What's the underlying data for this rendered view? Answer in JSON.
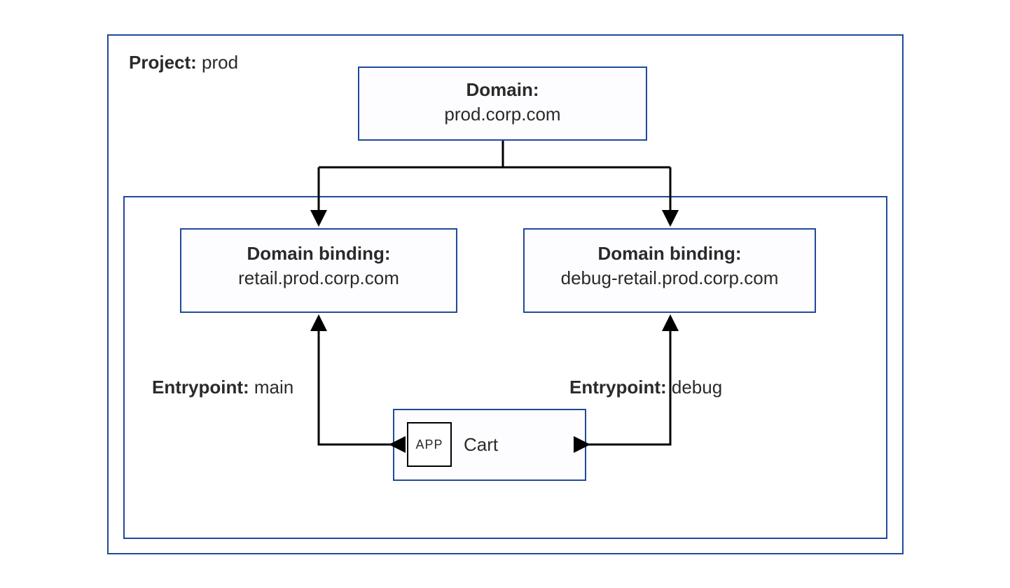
{
  "project": {
    "label_key": "Project:",
    "label_value": "prod"
  },
  "domain": {
    "title": "Domain:",
    "value": "prod.corp.com"
  },
  "bindings": {
    "left": {
      "title": "Domain binding:",
      "value": "retail.prod.corp.com"
    },
    "right": {
      "title": "Domain binding:",
      "value": "debug-retail.prod.corp.com"
    }
  },
  "entrypoints": {
    "left": {
      "label_key": "Entrypoint:",
      "label_value": "main"
    },
    "right": {
      "label_key": "Entrypoint:",
      "label_value": "debug"
    }
  },
  "app": {
    "badge": "APP",
    "name": "Cart"
  },
  "colors": {
    "outline": "#1f4a9c",
    "text": "#2a2a2a",
    "arrow": "#000000"
  }
}
